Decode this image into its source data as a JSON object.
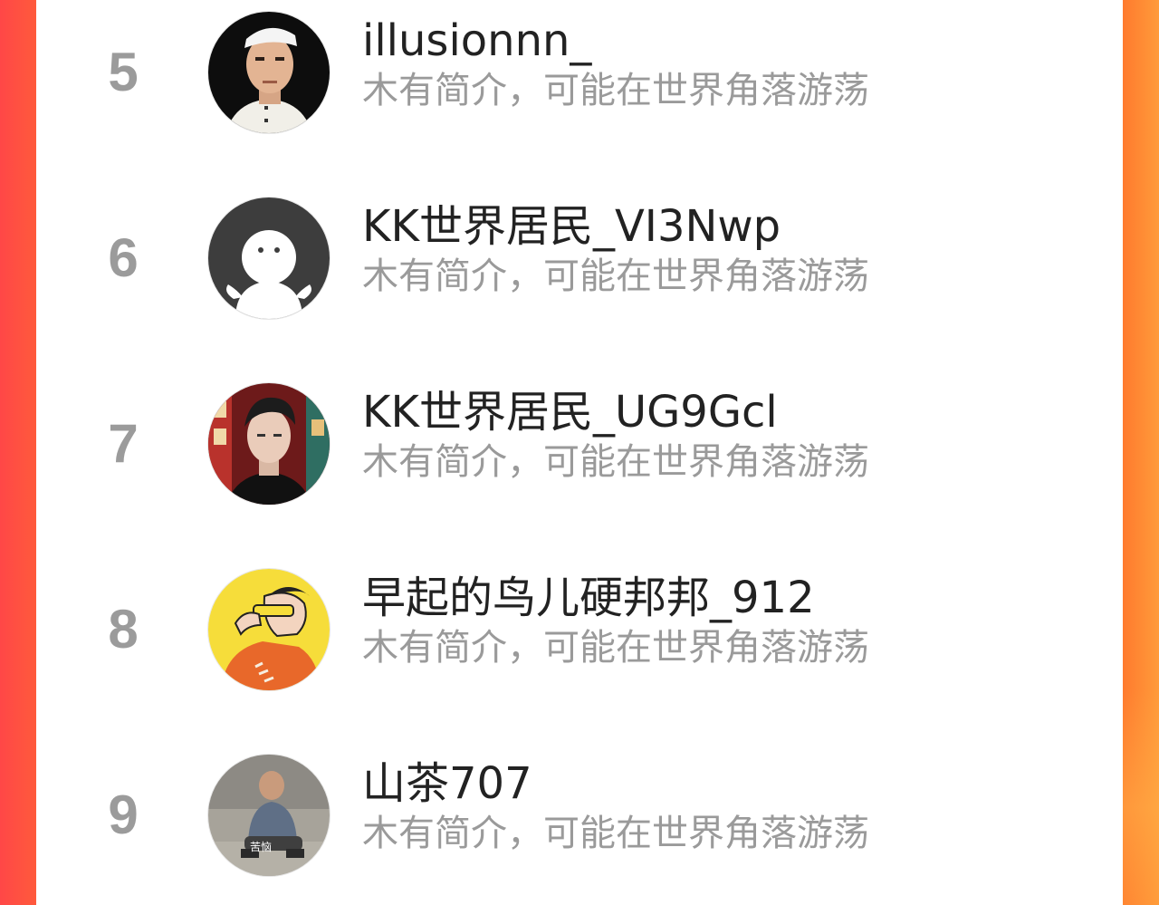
{
  "colors": {
    "accent_left": "#ff4747",
    "accent_right": "#ff8a34",
    "rank_gray": "#9b9b9b",
    "name_text": "#222222",
    "bio_text": "#9a9a9a",
    "panel_bg": "#ffffff"
  },
  "ranking": {
    "items": [
      {
        "rank": "5",
        "name": "illusionnn_",
        "bio": "木有简介，可能在世界角落游荡",
        "avatar_icon": "avatar-photo-icon"
      },
      {
        "rank": "6",
        "name": "KK世界居民_VI3Nwp",
        "bio": "木有简介，可能在世界角落游荡",
        "avatar_icon": "default-avatar-icon"
      },
      {
        "rank": "7",
        "name": "KK世界居民_UG9Gcl",
        "bio": "木有简介，可能在世界角落游荡",
        "avatar_icon": "avatar-photo-icon"
      },
      {
        "rank": "8",
        "name": "早起的鸟儿硬邦邦_912",
        "bio": "木有简介，可能在世界角落游荡",
        "avatar_icon": "avatar-illustration-icon"
      },
      {
        "rank": "9",
        "name": "山茶707",
        "bio": "木有简介，可能在世界角落游荡",
        "avatar_icon": "avatar-photo-icon",
        "avatar_caption": "苦恼"
      }
    ]
  }
}
